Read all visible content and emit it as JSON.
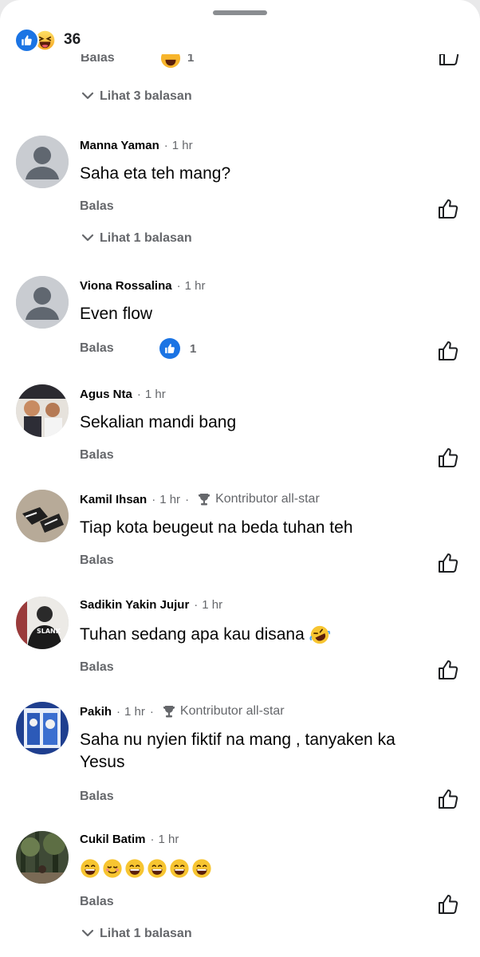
{
  "header": {
    "reaction_count": "36",
    "reaction_icons": [
      "like-icon",
      "haha-icon"
    ]
  },
  "top_fragment": {
    "reply_label": "Balas",
    "reaction_count": "1",
    "replies_link": "Lihat 3 balasan"
  },
  "comments": [
    {
      "author": "Manna Yaman",
      "time": "1 hr",
      "text": "Saha eta teh mang?",
      "reply_label": "Balas",
      "replies_link": "Lihat 1 balasan",
      "avatar": "default-avatar"
    },
    {
      "author": "Viona Rossalina",
      "time": "1 hr",
      "text": "Even flow",
      "reply_label": "Balas",
      "reaction_count": "1",
      "avatar": "default-avatar"
    },
    {
      "author": "Agus Nta",
      "time": "1 hr",
      "text": "Sekalian mandi bang",
      "reply_label": "Balas",
      "avatar": "photo-two-people"
    },
    {
      "author": "Kamil Ihsan",
      "time": "1 hr",
      "badge": "Kontributor all-star",
      "text": "Tiap kota beugeut na beda tuhan teh",
      "reply_label": "Balas",
      "avatar": "photo-sneakers"
    },
    {
      "author": "Sadikin Yakin Jujur",
      "time": "1 hr",
      "text": "Tuhan sedang apa kau disana",
      "reply_label": "Balas",
      "avatar": "photo-person-hoodie"
    },
    {
      "author": "Pakih",
      "time": "1 hr",
      "badge": "Kontributor all-star",
      "text": "Saha nu nyien fiktif na mang , tanyaken ka Yesus",
      "reply_label": "Balas",
      "avatar": "photo-blue-poster"
    },
    {
      "author": "Cukil Batim",
      "time": "1 hr",
      "text": "😄☺😄😄😄😄",
      "reply_label": "Balas",
      "replies_link": "Lihat 1 balasan",
      "avatar": "photo-forest"
    }
  ],
  "colors": {
    "accent": "#1b74e4",
    "secondary_text": "#65676b",
    "primary_text": "#050505",
    "background": "#ffffff"
  }
}
